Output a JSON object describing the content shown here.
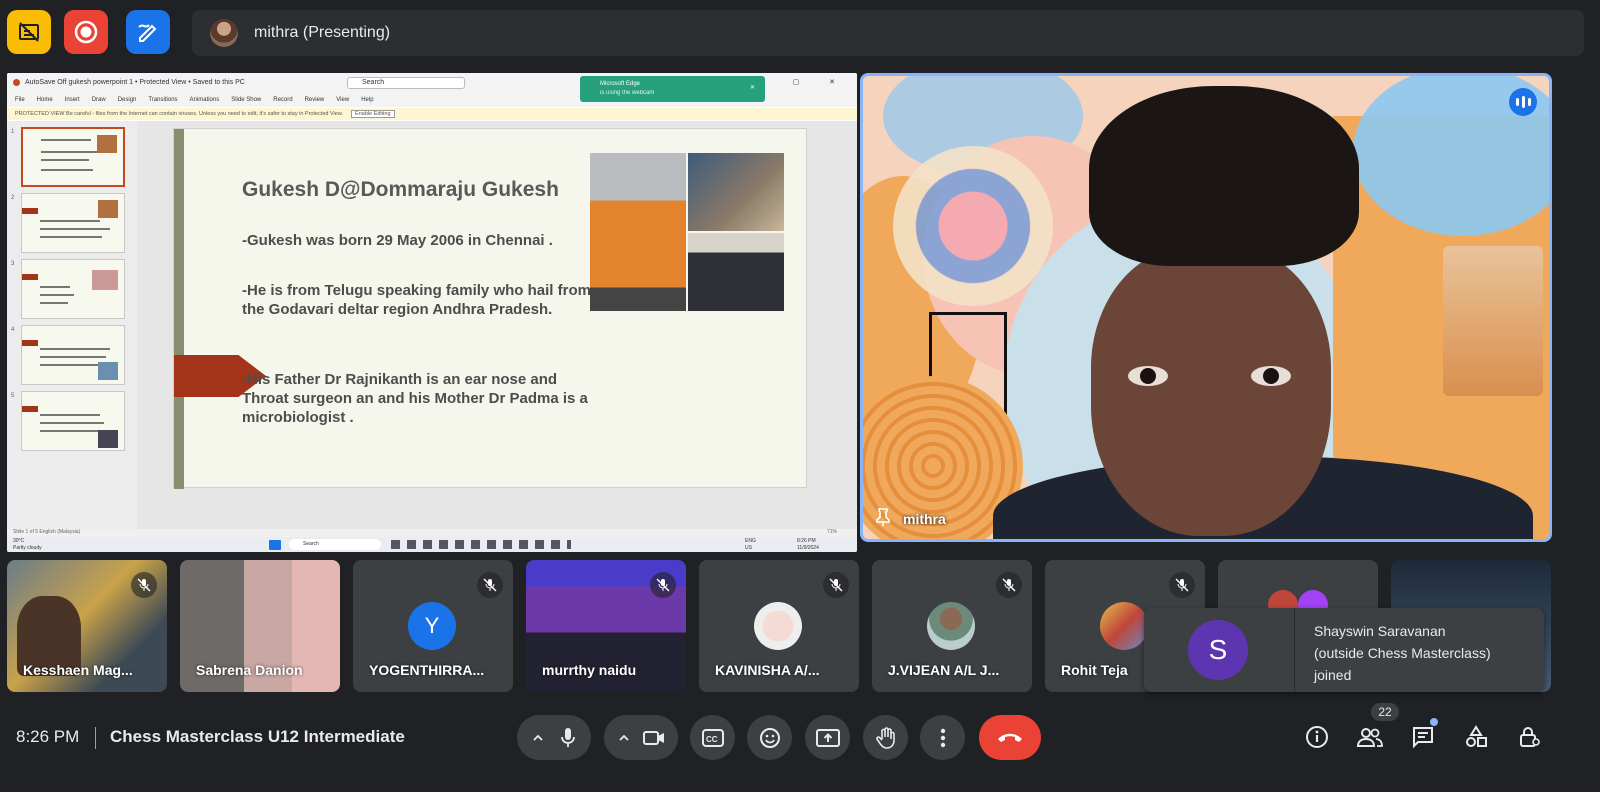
{
  "presenter_bar": {
    "label": "mithra (Presenting)"
  },
  "colors": {
    "accent": "#8ab4f8",
    "end_call": "#ea4335",
    "hide_btn": "#fbbc04",
    "record_btn": "#ea4335",
    "whiteboard_btn": "#1a73e8",
    "toast_avatar": "#5e35b1",
    "avatar_y": "#1a73e8"
  },
  "top_buttons": [
    {
      "name": "hide-self-view-icon"
    },
    {
      "name": "record-icon"
    },
    {
      "name": "whiteboard-icon"
    }
  ],
  "screen": {
    "ppt": {
      "title_bar": "AutoSave  Off   gukesh powerpoint 1 • Protected View • Saved to this PC",
      "search": "Search",
      "menu": [
        "File",
        "Home",
        "Insert",
        "Draw",
        "Design",
        "Transitions",
        "Animations",
        "Slide Show",
        "Record",
        "Review",
        "View",
        "Help"
      ],
      "warning": "PROTECTED VIEW  Be careful - files from the Internet can contain viruses. Unless you need to edit, it's safer to stay in Protected View.",
      "enable_editing": "Enable Editing",
      "notification_title": "Microsoft Edge",
      "notification_sub": "is using the webcam",
      "status_left": "Slide 1 of 5     English (Malaysia)",
      "status_right": "71%",
      "thumb_numbers": [
        "1",
        "2",
        "3",
        "4",
        "5"
      ]
    },
    "slide": {
      "title": "Gukesh D@Dommaraju Gukesh",
      "para1": "-Gukesh  was born 29 May 2006 in Chennai .",
      "para2": "-He is  from Telugu speaking family who hail from the Godavari deltar region Andhra Pradesh.",
      "para3": "-His Father Dr Rajnikanth is  an  ear nose and Throat surgeon an and  his Mother Dr Padma is a microbiologist ."
    },
    "taskbar": {
      "weather_temp": "30°C",
      "weather_desc": "Partly cloudy",
      "search": "Search",
      "lang": "ENG",
      "lang2": "US",
      "time": "8:26 PM",
      "date": "11/9/2024"
    }
  },
  "main_video": {
    "name": "mithra"
  },
  "participants": [
    {
      "name": "Kesshaen Mag...",
      "type": "video",
      "muted": true
    },
    {
      "name": "Sabrena Danion",
      "type": "video",
      "muted": false
    },
    {
      "name": "YOGENTHIRRA...",
      "type": "initial",
      "initial": "Y",
      "muted": true
    },
    {
      "name": "murrthy naidu",
      "type": "video",
      "muted": true
    },
    {
      "name": "KAVINISHA A/...",
      "type": "photo",
      "muted": true
    },
    {
      "name": "J.VIJEAN A/L J...",
      "type": "photo",
      "muted": true
    },
    {
      "name": "Rohit Teja",
      "type": "photo",
      "muted": true
    },
    {
      "name": "",
      "type": "hidden"
    },
    {
      "name": "",
      "type": "hidden"
    }
  ],
  "toast": {
    "initial": "S",
    "line1": "Shayswin Saravanan",
    "line2": "(outside Chess Masterclass)",
    "line3": "joined"
  },
  "bottom_bar": {
    "time": "8:26 PM",
    "meeting_title": "Chess Masterclass U12 Intermediate",
    "participant_count": "22"
  }
}
